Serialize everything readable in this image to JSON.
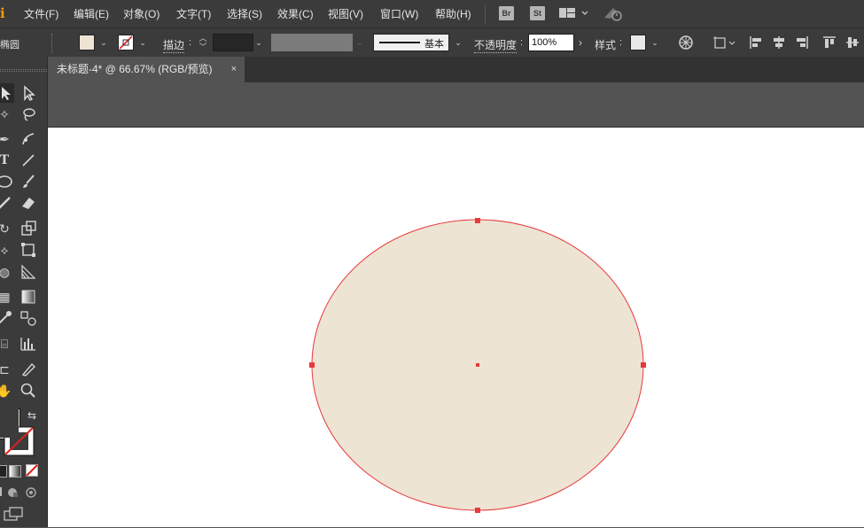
{
  "app": {
    "logo": "i"
  },
  "menu": [
    "文件(F)",
    "编辑(E)",
    "对象(O)",
    "文字(T)",
    "选择(S)",
    "效果(C)",
    "视图(V)",
    "窗口(W)",
    "帮助(H)"
  ],
  "app_buttons": {
    "bridge": "Br",
    "stock": "St"
  },
  "control": {
    "object_type": "椭圆",
    "stroke_label": "描边",
    "stroke_style": "基本",
    "opacity_label": "不透明度",
    "opacity_value": "100%",
    "style_label": "样式",
    "fill_color": "#ede4d3",
    "stroke_color": "#e8393d"
  },
  "document": {
    "tab_title": "未标题-4* @ 66.67% (RGB/预览)",
    "close": "×"
  },
  "canvas": {
    "ellipse_fill": "#ede4d3",
    "ellipse_stroke": "#e8393d"
  }
}
